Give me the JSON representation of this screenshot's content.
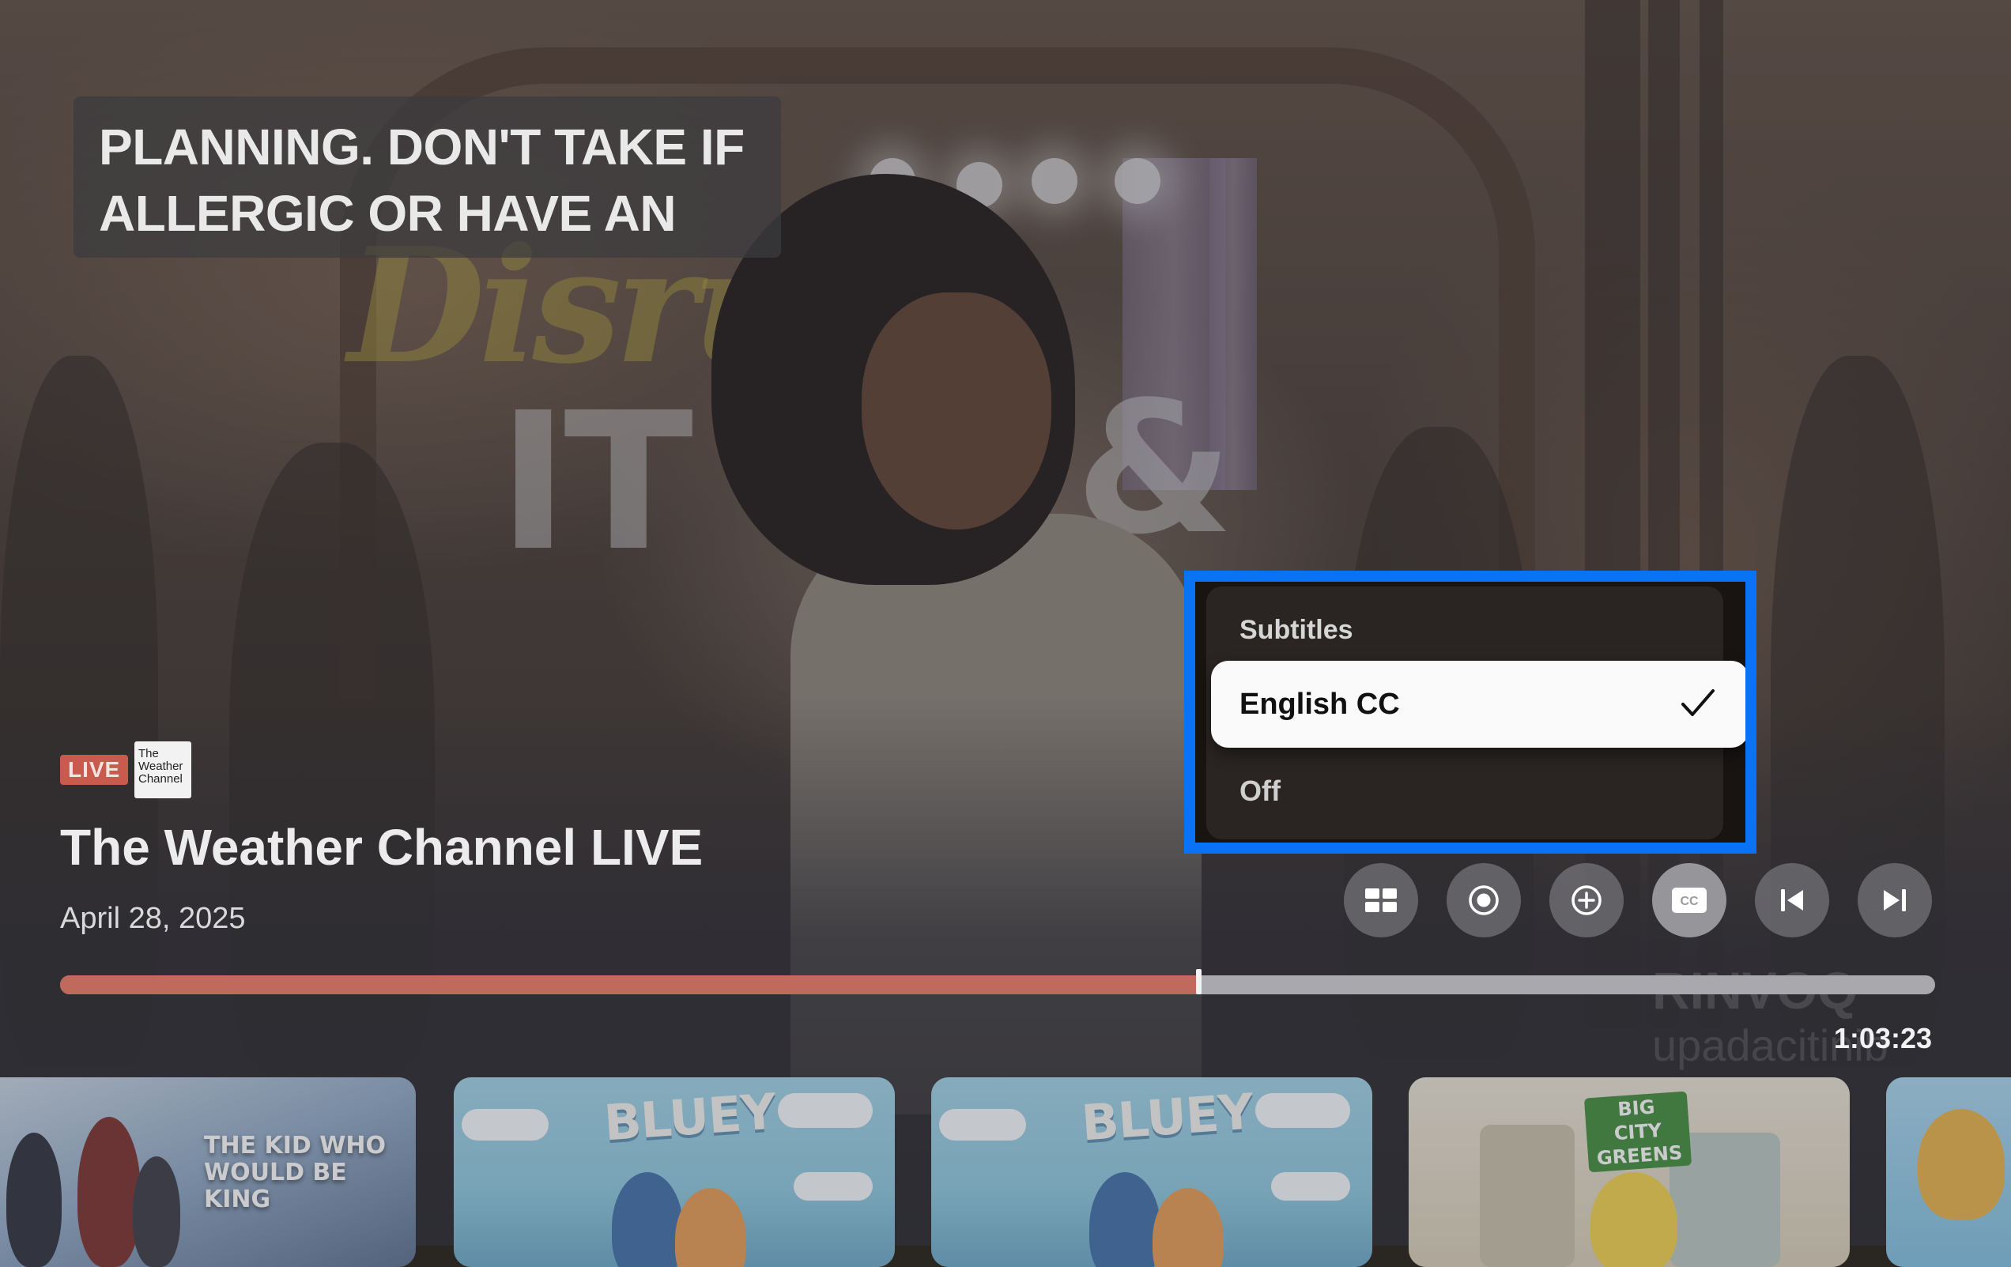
{
  "caption": {
    "lines": [
      "PLANNING. DON'T TAKE IF",
      "ALLERGIC OR HAVE AN"
    ]
  },
  "program": {
    "live_badge": "LIVE",
    "channel_logo": [
      "The",
      "Weather",
      "Channel"
    ],
    "title": "The Weather Channel LIVE",
    "date": "April 28, 2025"
  },
  "subtitles_menu": {
    "heading": "Subtitles",
    "options": [
      {
        "label": "English CC",
        "selected": true
      },
      {
        "label": "Off",
        "selected": false
      }
    ]
  },
  "controls": [
    {
      "name": "guide-button",
      "icon": "grid-icon"
    },
    {
      "name": "record-button",
      "icon": "record-icon"
    },
    {
      "name": "add-to-list-button",
      "icon": "plus-circle-icon"
    },
    {
      "name": "closed-captions-button",
      "icon": "cc-icon",
      "active": true
    },
    {
      "name": "previous-button",
      "icon": "skip-back-icon"
    },
    {
      "name": "next-button",
      "icon": "skip-forward-icon"
    }
  ],
  "playback": {
    "progress_fraction": 0.607,
    "time_remaining": "1:03:23"
  },
  "thumbnails": [
    {
      "title": "THE KID WHO WOULD BE KING"
    },
    {
      "title": "BLUEY"
    },
    {
      "title": "BLUEY"
    },
    {
      "title": "BIG CITY GREENS"
    },
    {
      "title": ""
    }
  ],
  "colors": {
    "accent_focus": "#0a73f5",
    "progress": "#c0695d",
    "live": "#c95a4e"
  }
}
